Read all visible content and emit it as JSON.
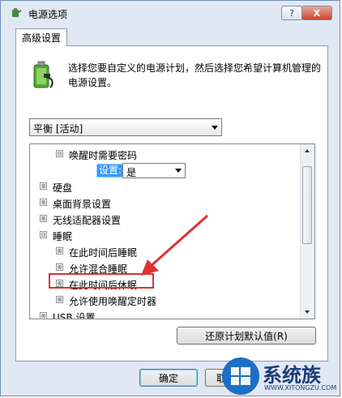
{
  "window": {
    "title": "电源选项",
    "help_label": "?",
    "close_label": "X"
  },
  "tab": {
    "label": "高级设置"
  },
  "description": "选择您要自定义的电源计划，然后选择您希望计算机管理的电源设置。",
  "plan_dropdown": {
    "value": "平衡 [活动]"
  },
  "tree": {
    "items": [
      {
        "label": "唤醒时需要密码",
        "expander": "⊟"
      },
      {
        "label": "硬盘",
        "expander": "⊞"
      },
      {
        "label": "桌面背景设置",
        "expander": "⊞"
      },
      {
        "label": "无线适配器设置",
        "expander": "⊞"
      },
      {
        "label": "睡眠",
        "expander": "⊟"
      },
      {
        "label": "在此时间后睡眠",
        "expander": "⊞"
      },
      {
        "label": "允许混合睡眠",
        "expander": "⊞"
      },
      {
        "label": "在此时间后休眠",
        "expander": "⊞"
      },
      {
        "label": "允许使用唤醒定时器",
        "expander": "⊞"
      },
      {
        "label": "USB 设置",
        "expander": "⊞"
      }
    ],
    "setting": {
      "label": "设置:",
      "value": "是"
    }
  },
  "buttons": {
    "restore": "还原计划默认值(R)",
    "ok": "确定",
    "cancel": "取"
  },
  "watermark": {
    "text": "系统族",
    "url": "WWW.XITONGZU.COM"
  },
  "colors": {
    "annotation": "#e03030",
    "selection": "#3399ff"
  }
}
